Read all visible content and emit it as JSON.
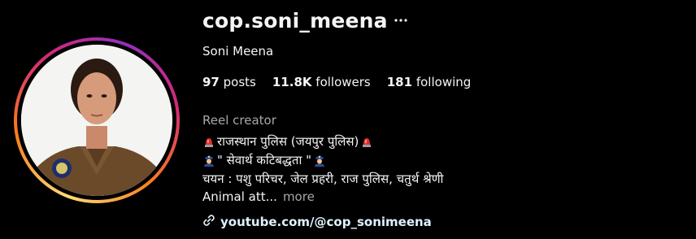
{
  "profile": {
    "username": "cop.soni_meena",
    "display_name": "Soni Meena",
    "options_icon": "more-horizontal-icon"
  },
  "stats": {
    "posts_count": "97",
    "posts_label": "posts",
    "followers_count": "11.8K",
    "followers_label": "followers",
    "following_count": "181",
    "following_label": "following"
  },
  "bio": {
    "category": "Reel creator",
    "line1": "राजस्थान पुलिस (जयपुर पुलिस)",
    "line2": "\" सेवार्थ कटिबद्धता \"",
    "line3": "चयन : पशु परिचर, जेल प्रहरी, राज पुलिस, चतुर्थ श्रेणी",
    "line4": "Animal att...",
    "more_label": "more",
    "line1_emoji": "police-light-emoji",
    "line2_emoji": "police-officer-emoji"
  },
  "link": {
    "icon": "link-icon",
    "url_text": "youtube.com/@cop_sonimeena"
  },
  "colors": {
    "background": "#000000",
    "text": "#f5f5f5",
    "secondary_text": "#a8a8a8",
    "link_text": "#e0f1ff",
    "story_ring_start": "#feda75",
    "story_ring_end": "#d62976"
  }
}
